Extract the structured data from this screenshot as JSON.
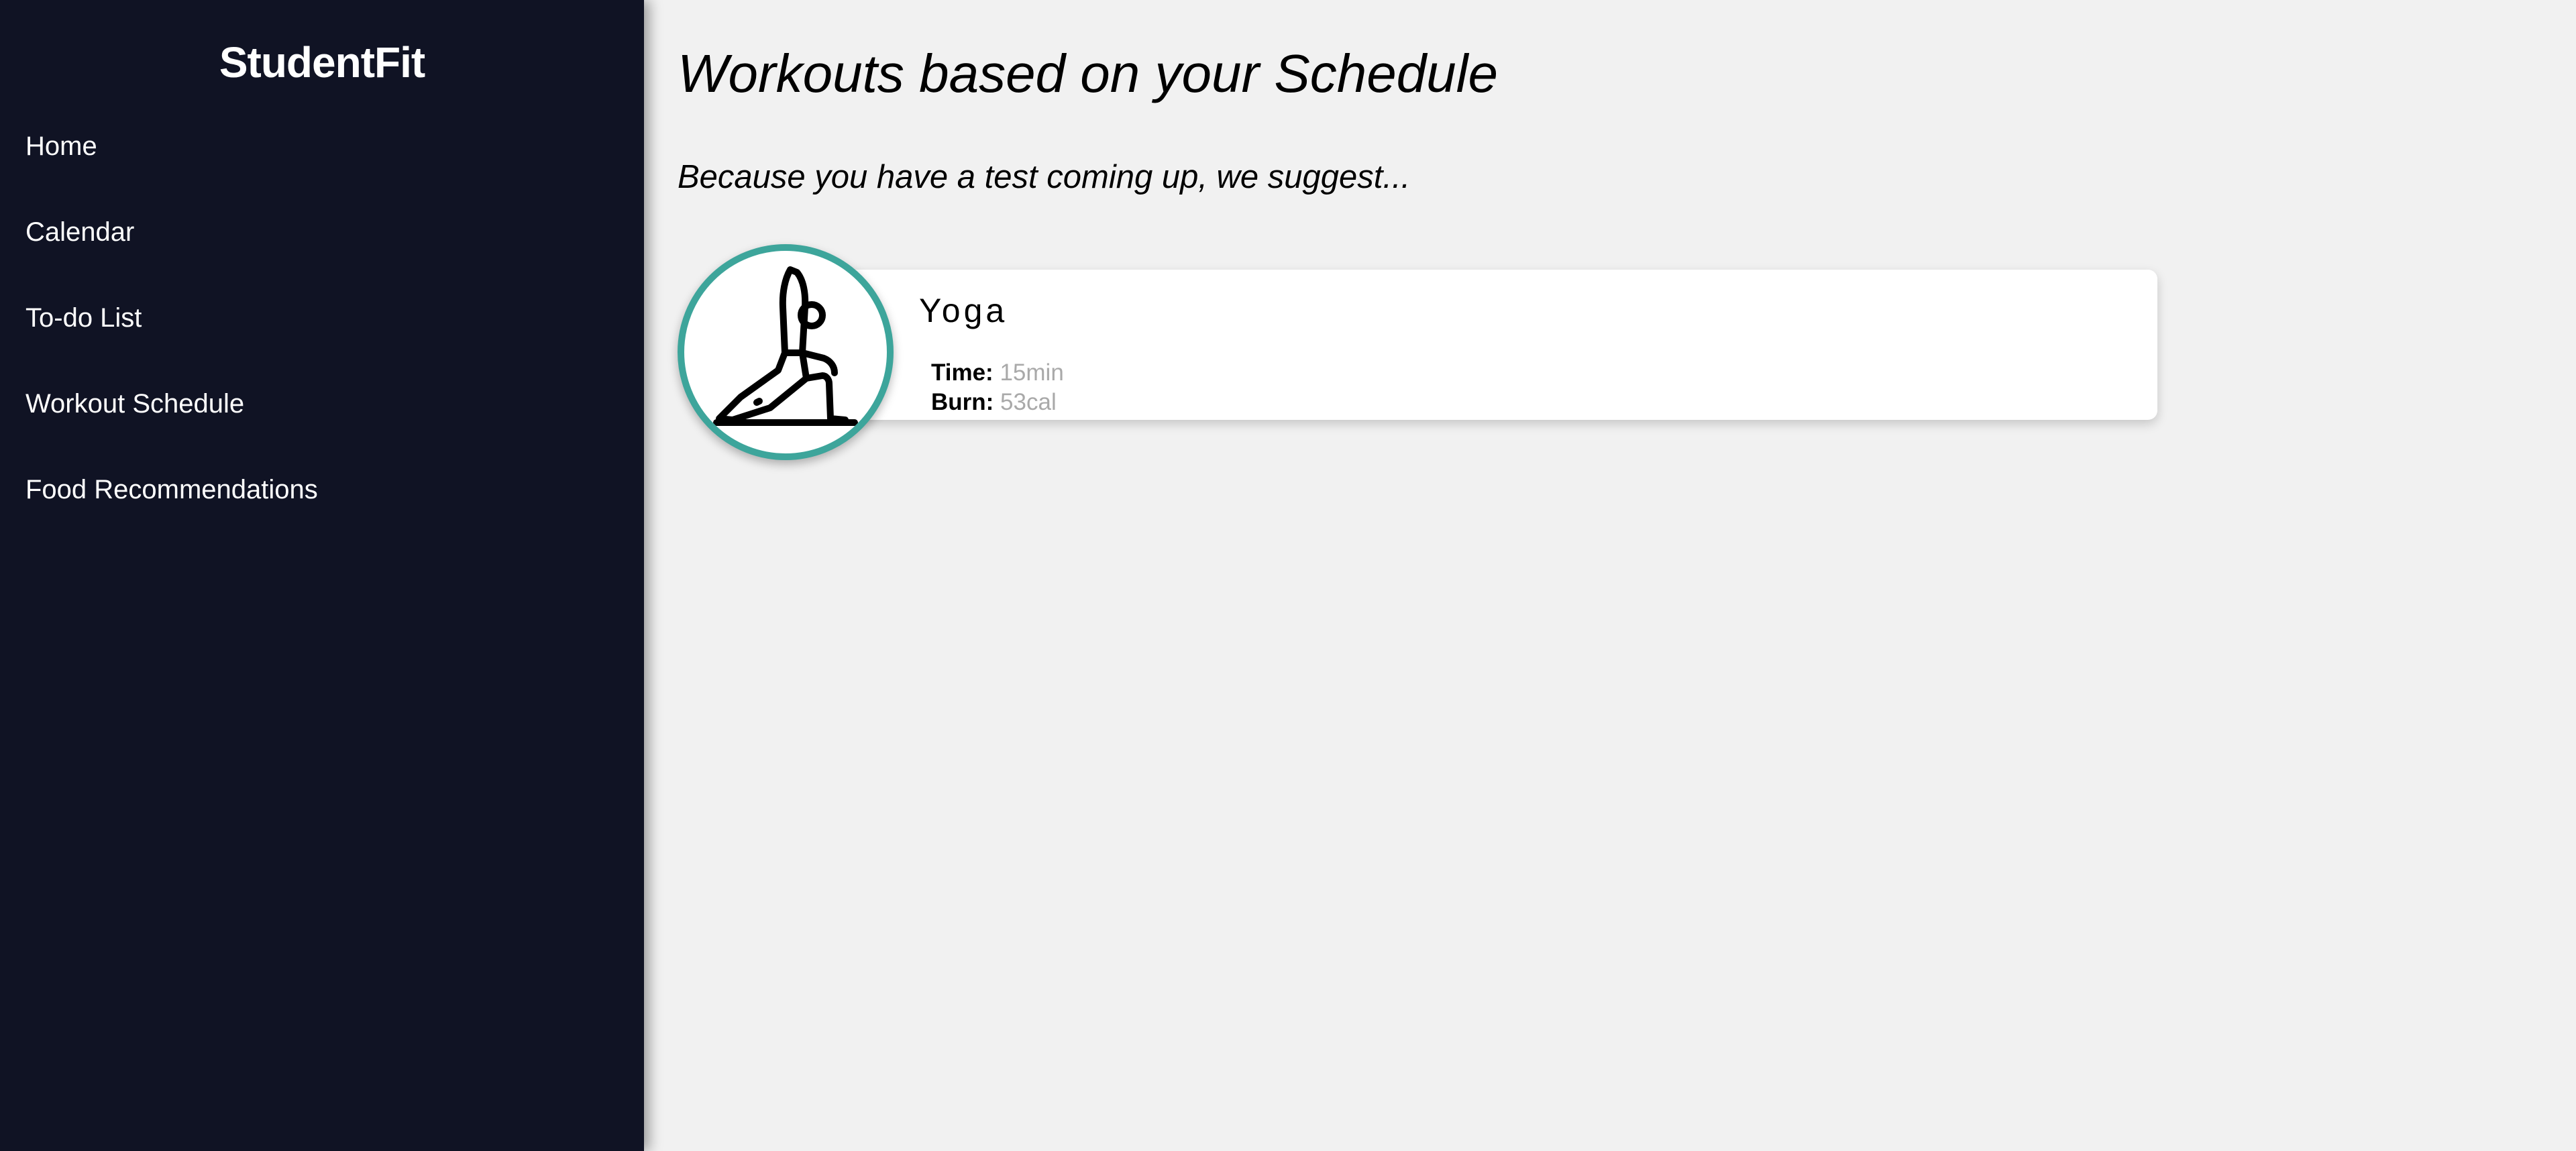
{
  "app": {
    "brand": "StudentFit"
  },
  "sidebar": {
    "items": [
      {
        "label": "Home"
      },
      {
        "label": "Calendar"
      },
      {
        "label": "To-do List"
      },
      {
        "label": "Workout Schedule"
      },
      {
        "label": "Food Recommendations"
      }
    ]
  },
  "main": {
    "title": "Workouts based on your Schedule",
    "subtitle": "Because you have a test coming up, we suggest...",
    "workout": {
      "name": "Yoga",
      "icon": "yoga-pose-icon",
      "time_label": "Time:",
      "time_value": "15min",
      "burn_label": "Burn:",
      "burn_value": "53cal"
    }
  },
  "colors": {
    "sidebar_bg": "#101324",
    "accent": "#3da59b",
    "page_bg": "#f1f1f1"
  }
}
